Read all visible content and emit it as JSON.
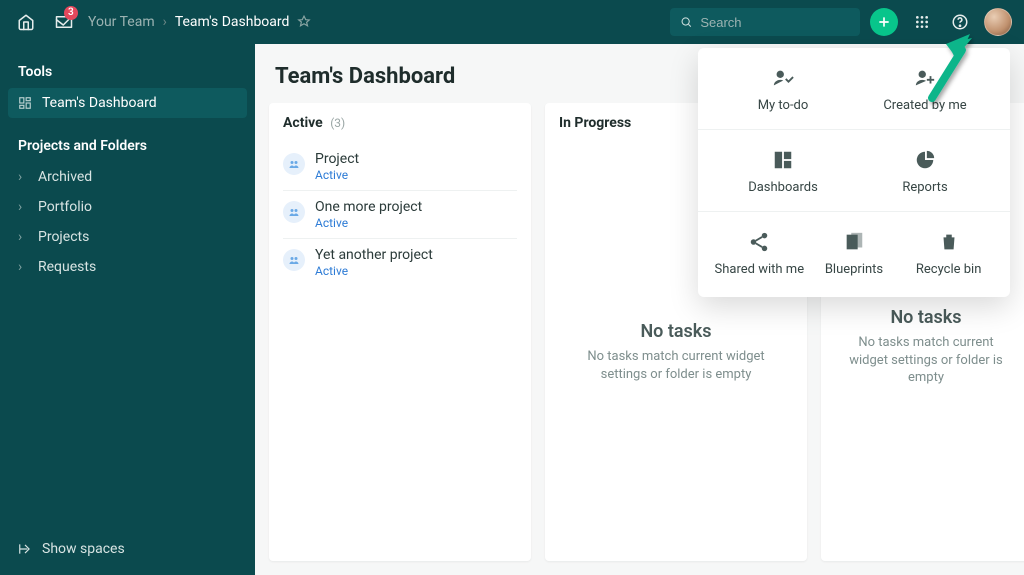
{
  "header": {
    "inbox_count": "3",
    "team_label": "Your Team",
    "current_label": "Team's Dashboard",
    "search_placeholder": "Search"
  },
  "sidebar": {
    "tools_title": "Tools",
    "tools_item_0": "Team's Dashboard",
    "projects_title": "Projects and Folders",
    "pf_item_0": "Archived",
    "pf_item_1": "Portfolio",
    "pf_item_2": "Projects",
    "pf_item_3": "Requests",
    "show_spaces": "Show spaces"
  },
  "page": {
    "title": "Team's Dashboard"
  },
  "columns": {
    "active": {
      "title": "Active",
      "count": "(3)",
      "items": [
        {
          "name": "Project",
          "status": "Active"
        },
        {
          "name": "One more project",
          "status": "Active"
        },
        {
          "name": "Yet another project",
          "status": "Active"
        }
      ]
    },
    "in_progress": {
      "title": "In Progress",
      "empty_title": "No tasks",
      "empty_desc": "No tasks match current widget settings or folder is empty"
    },
    "third": {
      "empty_title": "No tasks",
      "empty_desc": "No tasks match current widget settings or folder is empty"
    }
  },
  "apps_panel": {
    "my_todo": "My to-do",
    "created_by_me": "Created by me",
    "dashboards": "Dashboards",
    "reports": "Reports",
    "shared_with_me": "Shared with me",
    "blueprints": "Blueprints",
    "recycle_bin": "Recycle bin"
  }
}
